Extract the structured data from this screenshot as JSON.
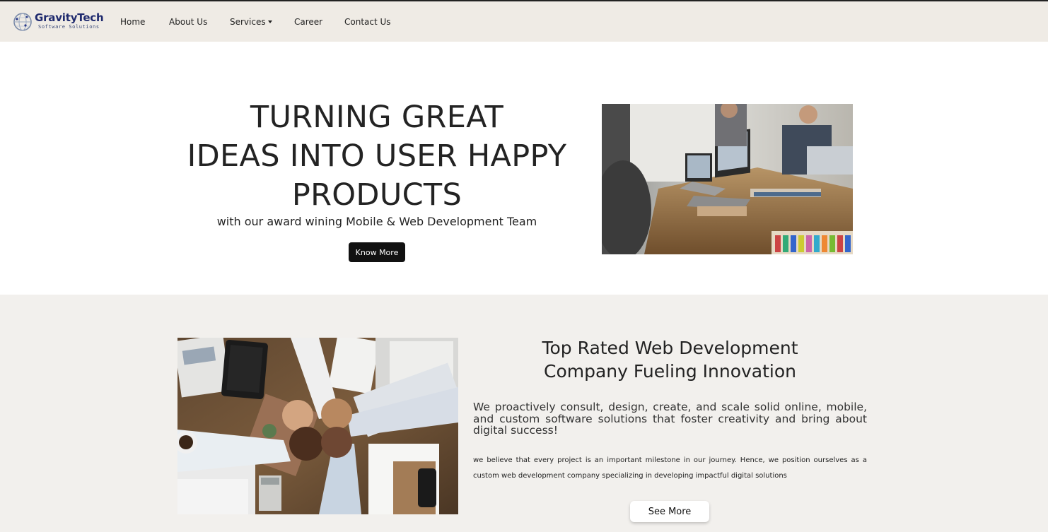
{
  "nav": {
    "logo_name": "GravityTech",
    "logo_sub": "Software Solutions",
    "items": [
      {
        "label": "Home"
      },
      {
        "label": "About Us"
      },
      {
        "label": "Services"
      },
      {
        "label": "Career"
      },
      {
        "label": "Contact Us"
      }
    ]
  },
  "hero": {
    "title_lines": [
      "TURNING GREAT",
      "IDEAS INTO USER HAPPY",
      "PRODUCTS"
    ],
    "subtitle": "with our award wining Mobile & Web Development Team",
    "button_label": "Know More"
  },
  "about": {
    "title_lines": [
      "Top Rated Web Development",
      "Company Fueling Innovation"
    ],
    "lead": "We proactively consult, design, create, and scale solid online, mobile, and custom software solutions that foster creativity and bring about digital success!",
    "body": "we believe that every project is an important milestone in our journey. Hence, we position ourselves as a custom web development company specializing in developing impactful digital solutions",
    "button_label": "See More"
  },
  "colors": {
    "navbar_bg": "#efebe5",
    "section_bg": "#f2f0ed",
    "brand": "#1f2a6e",
    "dark_button": "#111111"
  }
}
